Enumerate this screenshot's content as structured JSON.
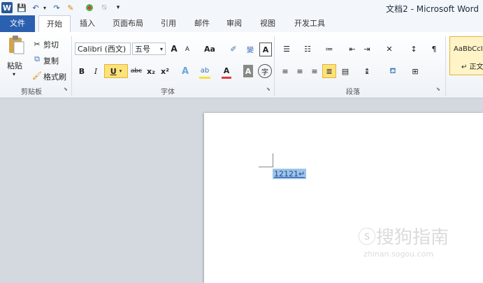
{
  "titlebar": {
    "title": "文档2  -  Microsoft Word",
    "quick_access": {
      "logo": "W",
      "save": "💾",
      "undo": "↶",
      "redo": "↷"
    }
  },
  "tabs": [
    {
      "label": "文件"
    },
    {
      "label": "开始"
    },
    {
      "label": "插入"
    },
    {
      "label": "页面布局"
    },
    {
      "label": "引用"
    },
    {
      "label": "邮件"
    },
    {
      "label": "审阅"
    },
    {
      "label": "视图"
    },
    {
      "label": "开发工具"
    }
  ],
  "clipboard": {
    "paste": "粘贴",
    "cut": "剪切",
    "copy": "复制",
    "format_painter": "格式刷",
    "group_label": "剪贴板"
  },
  "font": {
    "font_name": "Calibri (西文)",
    "font_size": "五号",
    "grow": "A",
    "shrink": "A",
    "case": "Aa",
    "bold": "B",
    "italic": "I",
    "underline": "U",
    "strike": "abc",
    "subscript": "x₂",
    "superscript": "x²",
    "group_label": "字体"
  },
  "paragraph": {
    "group_label": "段落"
  },
  "styles": {
    "normal_preview": "AaBbCcI",
    "normal_label": "↵ 正文"
  },
  "document": {
    "text": "12121↵"
  },
  "watermark": {
    "text": "ⓢ搜狗指南",
    "sub": "zhinan.sogou.com"
  },
  "colors": {
    "accent": "#2b5fb0",
    "selection": "#9ec3e6",
    "highlight_button": "#fce27a"
  }
}
